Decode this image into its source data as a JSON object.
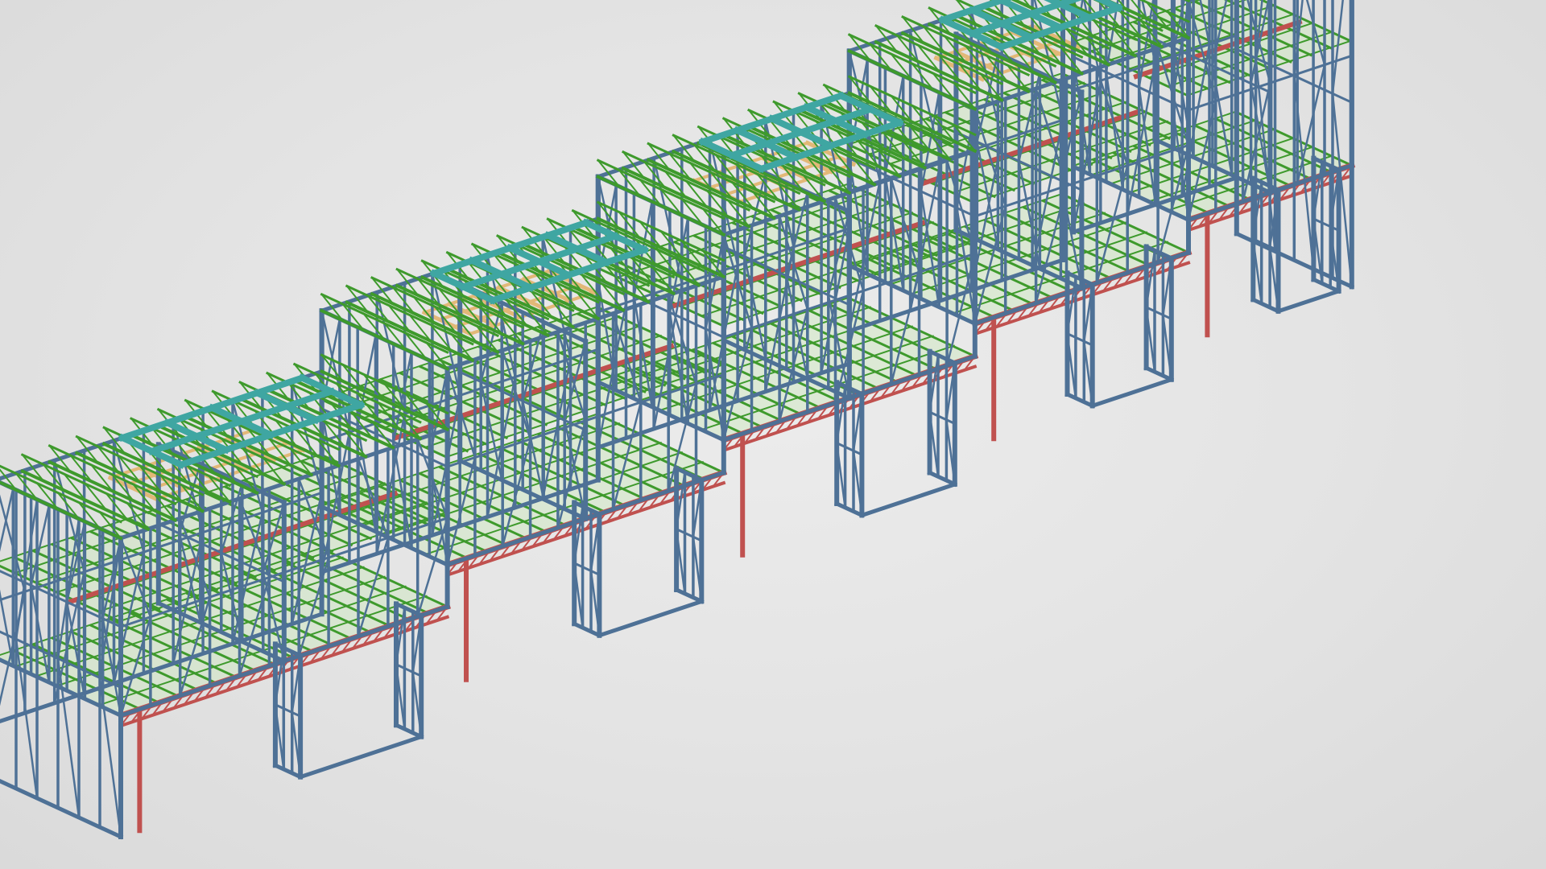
{
  "viewer": {
    "background_color": "#e2e2e2"
  },
  "model": {
    "subject": "steel-frame-building-3d-model",
    "colors": {
      "wall_frame": "#4e7196",
      "floor_joist": "#3e9a2c",
      "roof_truss_panel": "#3fa6a2",
      "bearer_beam": "#c0514f",
      "timber_decking": "#e2b877",
      "floor_sheet": "#cfe8c2"
    },
    "bay_count": 5
  }
}
